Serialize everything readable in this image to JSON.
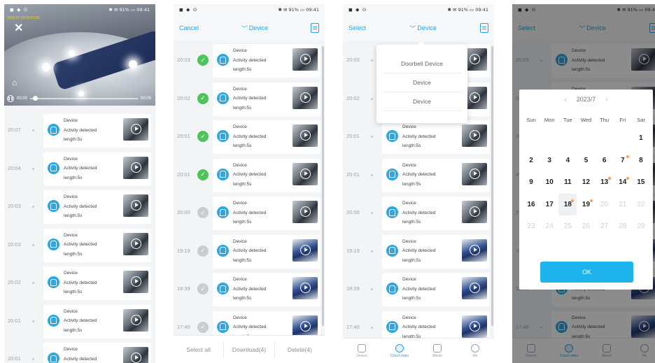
{
  "status": {
    "left_icons": "◼ ◆ ⊙",
    "right": "✱ ✉ 91% ▭ 09:41"
  },
  "panel1": {
    "overlay_time": "2023-07-19 20:01:23",
    "video_start": "00:00",
    "video_end": "00:05",
    "rows": [
      {
        "time": "20:07"
      },
      {
        "time": "20:04"
      },
      {
        "time": "20:03"
      },
      {
        "time": "20:03"
      },
      {
        "time": "20:02"
      },
      {
        "time": "20:01"
      },
      {
        "time": "20:01"
      }
    ]
  },
  "event": {
    "device": "Device",
    "activity": "Activity detected",
    "length": "length:5s"
  },
  "panel2": {
    "cancel": "Cancel",
    "device_filter": "Device",
    "rows": [
      {
        "time": "20:03",
        "checked": true
      },
      {
        "time": "20:02",
        "checked": true
      },
      {
        "time": "20:01",
        "checked": true
      },
      {
        "time": "20:01",
        "checked": true
      },
      {
        "time": "20:00",
        "checked": false
      },
      {
        "time": "19:19",
        "checked": false
      },
      {
        "time": "18:39",
        "checked": false
      },
      {
        "time": "17:40",
        "checked": false
      }
    ],
    "select_all": "Select all",
    "download": "Download(4)",
    "delete": "Delete(4)"
  },
  "panel3": {
    "select": "Select",
    "device_filter": "Device",
    "dropdown": [
      "Doorbell Device",
      "Device",
      "Device"
    ],
    "rows": [
      {
        "time": "20:03"
      },
      {
        "time": "20:02"
      },
      {
        "time": "20:01"
      },
      {
        "time": "20:01"
      },
      {
        "time": "20:00"
      },
      {
        "time": "19:19"
      },
      {
        "time": "18:39"
      },
      {
        "time": "17:40"
      }
    ],
    "tabs": [
      "Device",
      "Cloud video",
      "Album",
      "Me"
    ]
  },
  "panel4": {
    "select": "Select",
    "device_filter": "Device",
    "month": "2023/7",
    "weekdays": [
      "Sun",
      "Mon",
      "Tue",
      "Wed",
      "Thu",
      "Fri",
      "Sat"
    ],
    "days": [
      {
        "d": "",
        "s": "empty"
      },
      {
        "d": "",
        "s": "empty"
      },
      {
        "d": "",
        "s": "empty"
      },
      {
        "d": "",
        "s": "empty"
      },
      {
        "d": "",
        "s": "empty"
      },
      {
        "d": "",
        "s": "empty"
      },
      {
        "d": "1",
        "s": "on"
      },
      {
        "d": "2",
        "s": "on"
      },
      {
        "d": "3",
        "s": "on"
      },
      {
        "d": "4",
        "s": "on"
      },
      {
        "d": "5",
        "s": "on"
      },
      {
        "d": "6",
        "s": "on"
      },
      {
        "d": "7",
        "s": "on",
        "mark": true
      },
      {
        "d": "8",
        "s": "on"
      },
      {
        "d": "9",
        "s": "on"
      },
      {
        "d": "10",
        "s": "on"
      },
      {
        "d": "11",
        "s": "on"
      },
      {
        "d": "12",
        "s": "on"
      },
      {
        "d": "13",
        "s": "on",
        "mark": true
      },
      {
        "d": "14",
        "s": "on",
        "mark": true
      },
      {
        "d": "15",
        "s": "on"
      },
      {
        "d": "16",
        "s": "on"
      },
      {
        "d": "17",
        "s": "on"
      },
      {
        "d": "18",
        "s": "sel",
        "mark": true
      },
      {
        "d": "19",
        "s": "on",
        "mark": true
      },
      {
        "d": "20",
        "s": "dis"
      },
      {
        "d": "21",
        "s": "dis"
      },
      {
        "d": "22",
        "s": "dis"
      },
      {
        "d": "23",
        "s": "dis"
      },
      {
        "d": "24",
        "s": "dis"
      },
      {
        "d": "25",
        "s": "dis"
      },
      {
        "d": "26",
        "s": "dis"
      },
      {
        "d": "27",
        "s": "dis"
      },
      {
        "d": "28",
        "s": "dis"
      },
      {
        "d": "29",
        "s": "dis"
      }
    ],
    "ok": "OK",
    "bg_time": "17:40"
  },
  "colors": {
    "accent": "#29a3e0",
    "check_on": "#4cc45a",
    "ok_button": "#1eb3ec"
  }
}
